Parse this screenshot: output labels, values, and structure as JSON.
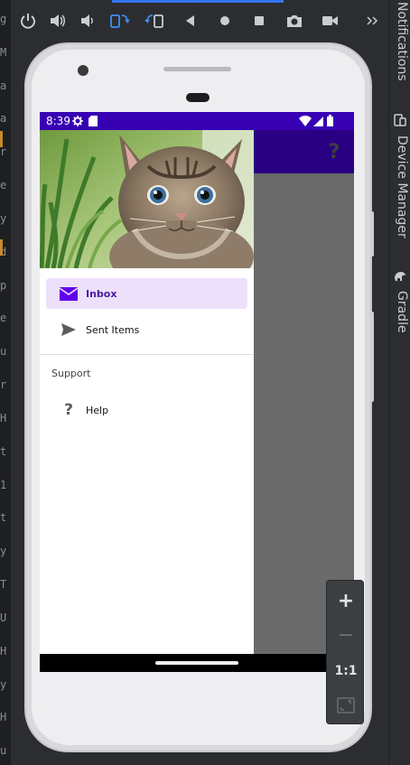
{
  "ide": {
    "gutter_chars": [
      "g",
      "M",
      "a",
      "a",
      "r",
      "e",
      "y",
      "d",
      "p",
      "e",
      "u",
      "r",
      "H",
      "t",
      "1",
      "t",
      "y",
      "T",
      "U",
      "H",
      "y",
      "H",
      "u"
    ],
    "toolbar_icons": [
      "power-icon",
      "volume-up-icon",
      "volume-down-icon",
      "rotate-left-icon",
      "rotate-right-icon",
      "back-icon",
      "home-icon",
      "overview-icon",
      "camera-icon",
      "video-icon",
      "more-icon"
    ],
    "side_tools": [
      "Notifications",
      "Device Manager",
      "Gradle"
    ],
    "zoom": {
      "in": "+",
      "out": "−",
      "actual": "1:1"
    }
  },
  "status_bar": {
    "time": "8:39"
  },
  "app_bar": {
    "help_icon": "?"
  },
  "drawer": {
    "items": [
      {
        "label": "Inbox",
        "icon": "mail-icon",
        "active": true
      },
      {
        "label": "Sent Items",
        "icon": "send-icon",
        "active": false
      }
    ],
    "section_title": "Support",
    "support_items": [
      {
        "label": "Help",
        "icon": "help-icon"
      }
    ]
  },
  "colors": {
    "status_bar": "#3700b3",
    "app_bar": "#2a0082",
    "active_item_bg": "#ede0fb",
    "accent_icon": "#6200ee"
  }
}
